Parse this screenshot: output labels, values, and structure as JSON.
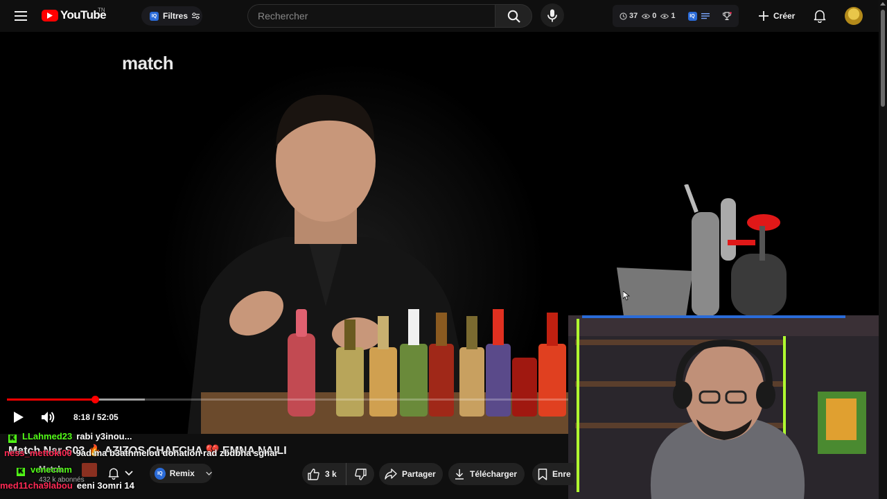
{
  "header": {
    "logo_text": "YouTube",
    "logo_region": "TN",
    "filter_label": "Filtres",
    "iq_label": "IQ",
    "search_placeholder": "Rechercher",
    "stats": {
      "clock": "37",
      "eye1": "0",
      "eye2": "1"
    },
    "create_label": "Créer"
  },
  "player": {
    "watermark": "match",
    "current_time": "8:18",
    "duration": "52:05",
    "time_display": "8:18 / 52:05",
    "progress_played": 0.157,
    "progress_buffered": 0.246
  },
  "video": {
    "title": "Match Nar S03 🔥 AZIZOS CHAFCHA 💔 EMNA NAILI",
    "channel_name": "Match",
    "channel_subs": "432 k abonnés"
  },
  "actions": {
    "remix_label": "Remix",
    "like_count": "3 k",
    "share_label": "Partager",
    "download_label": "Télécharger",
    "save_label": "Enre"
  },
  "chat": [
    {
      "badge": "K",
      "user": "LLahmed23",
      "message": "rabi y3inou..."
    },
    {
      "badge": "",
      "user": "ness_mettoki00",
      "message": "9ad ma b3athmelou donation rad zbdbha sghar"
    },
    {
      "badge": "K",
      "user": "venecmm",
      "message": ""
    },
    {
      "badge": "",
      "user": "med11cha9labou",
      "message": "eeni 3omri 14"
    }
  ],
  "colors": {
    "accent": "#ff0000",
    "kick_green": "#53fc18",
    "chat_red": "#ff2a55",
    "iq_blue": "#2a6bd8"
  }
}
